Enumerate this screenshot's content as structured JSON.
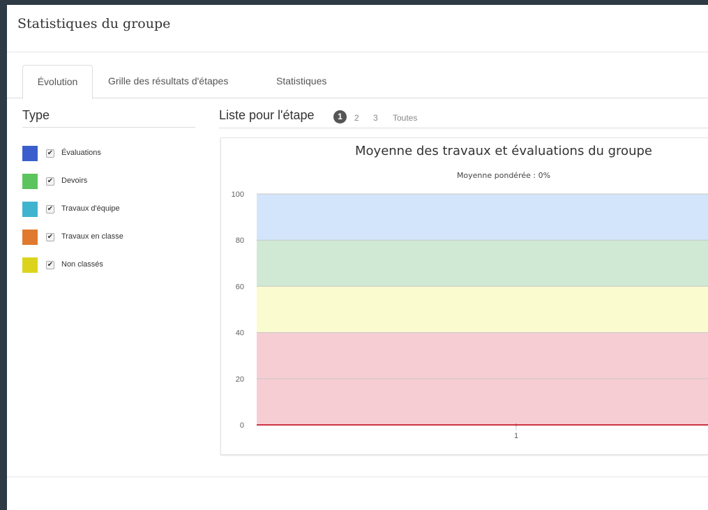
{
  "header": {
    "title": "Statistiques du groupe"
  },
  "tabs": [
    {
      "label": "Évolution",
      "active": true
    },
    {
      "label": "Grille des résultats d'étapes",
      "active": false
    },
    {
      "label": "Statistiques",
      "active": false
    }
  ],
  "sidebar": {
    "heading": "Type",
    "items": [
      {
        "label": "Évaluations",
        "color": "#3a5fcd",
        "checked": true
      },
      {
        "label": "Devoirs",
        "color": "#5cc45c",
        "checked": true
      },
      {
        "label": "Travaux d'équipe",
        "color": "#40b4cf",
        "checked": true
      },
      {
        "label": "Travaux en classe",
        "color": "#e07a2e",
        "checked": true
      },
      {
        "label": "Non classés",
        "color": "#dcd41c",
        "checked": true
      }
    ]
  },
  "steps": {
    "title": "Liste pour l'étape",
    "current": "1",
    "others": [
      "2",
      "3",
      "Toutes"
    ]
  },
  "chart_data": {
    "type": "line",
    "title": "Moyenne des travaux et évaluations du groupe",
    "subtitle": "Moyenne pondérée : 0%",
    "categories": [
      "1"
    ],
    "ylim": [
      0,
      100
    ],
    "yticks": [
      0,
      20,
      40,
      60,
      80,
      100
    ],
    "bands": [
      {
        "from": 80,
        "to": 100,
        "color": "#d3e5fa"
      },
      {
        "from": 60,
        "to": 80,
        "color": "#d0e9d4"
      },
      {
        "from": 40,
        "to": 60,
        "color": "#fbfbd0"
      },
      {
        "from": 0,
        "to": 40,
        "color": "#f6cdd3"
      }
    ],
    "series": [
      {
        "values": [
          0
        ],
        "color": "#cc3344"
      }
    ],
    "grid": true
  }
}
